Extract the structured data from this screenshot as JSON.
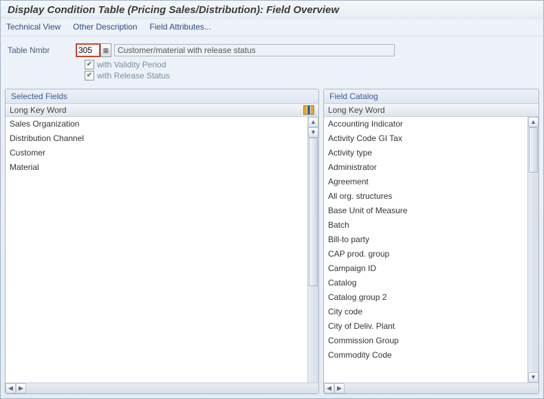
{
  "title": "Display Condition Table (Pricing Sales/Distribution): Field Overview",
  "menu": {
    "technical": "Technical View",
    "other": "Other Description",
    "attrs": "Field Attributes..."
  },
  "form": {
    "table_nmbr_label": "Table Nmbr",
    "table_nmbr_value": "305",
    "table_desc": "Customer/material with release status",
    "validity_label": "with Validity Period",
    "release_label": "with Release Status",
    "check_mark": "✔"
  },
  "left_panel": {
    "title": "Selected Fields",
    "col": "Long Key Word",
    "rows": [
      "Sales Organization",
      "Distribution Channel",
      "Customer",
      "Material"
    ]
  },
  "right_panel": {
    "title": "Field Catalog",
    "col": "Long Key Word",
    "rows": [
      "Accounting Indicator",
      "Activity Code GI Tax",
      "Activity type",
      "Administrator",
      "Agreement",
      "All org. structures",
      "Base Unit of Measure",
      "Batch",
      "Bill-to party",
      "CAP prod. group",
      "Campaign ID",
      "Catalog",
      "Catalog group 2",
      "City code",
      "City of Deliv. Plant",
      "Commission Group",
      "Commodity Code"
    ]
  },
  "glyph": {
    "up": "▲",
    "down": "▼",
    "left": "◀",
    "right": "▶"
  }
}
